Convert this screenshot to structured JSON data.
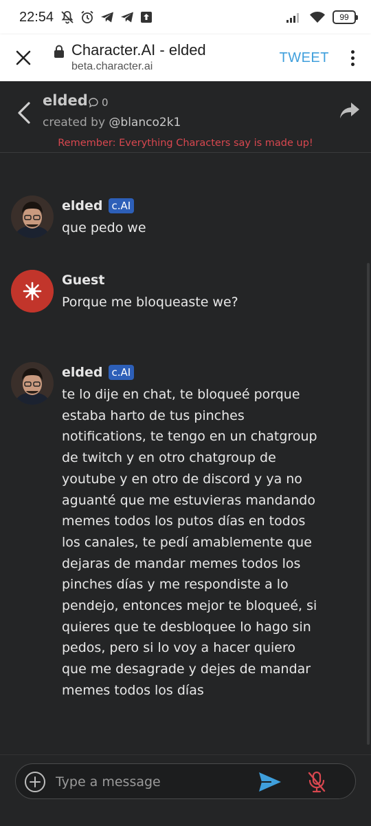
{
  "status_bar": {
    "time": "22:54",
    "battery": "99"
  },
  "browser": {
    "page_title": "Character.AI - elded",
    "host": "beta.character.ai",
    "tweet_label": "TWEET"
  },
  "chat_header": {
    "character_name": "elded",
    "chat_count": "0",
    "created_by_prefix": "created by",
    "creator_handle": "@blanco2k1",
    "disclaimer": "Remember: Everything Characters say is made up!"
  },
  "messages": [
    {
      "sender": "elded",
      "badge": "c.AI",
      "text": "que pedo we"
    },
    {
      "sender": "Guest",
      "badge": "",
      "text": "Porque me bloqueaste we?"
    },
    {
      "sender": "elded",
      "badge": "c.AI",
      "text": "te lo dije en chat, te bloqueé porque estaba harto de tus pinches notifications, te tengo en un chatgroup de twitch y en otro chatgroup de youtube y en otro de discord y ya no aguanté que me estuvieras mandando memes todos los putos días en todos los canales, te pedí amablemente que dejaras de mandar memes todos los pinches días y me respondiste a lo pendejo, entonces mejor te bloqueé, si quieres que te desbloquee lo hago sin pedos, pero si lo voy a hacer quiero que me desagrade y dejes de mandar memes todos los días"
    }
  ],
  "composer": {
    "placeholder": "Type a message"
  },
  "colors": {
    "background": "#242526",
    "disclaimer": "#d8474f",
    "badge": "#2d5fb8",
    "guest_avatar": "#c2352b",
    "tweet": "#3f9fdc",
    "send_icon": "#3f9fdc",
    "mic_muted": "#d8474f"
  },
  "icons": [
    "do-not-disturb-icon",
    "alarm-icon",
    "telegram-icon",
    "upload-icon",
    "signal-icon",
    "wifi-icon",
    "battery-icon",
    "close-icon",
    "lock-icon",
    "more-vert-icon",
    "back-chevron-icon",
    "chat-bubble-icon",
    "share-arrow-icon",
    "plus-circle-icon",
    "send-icon",
    "mic-off-icon"
  ]
}
